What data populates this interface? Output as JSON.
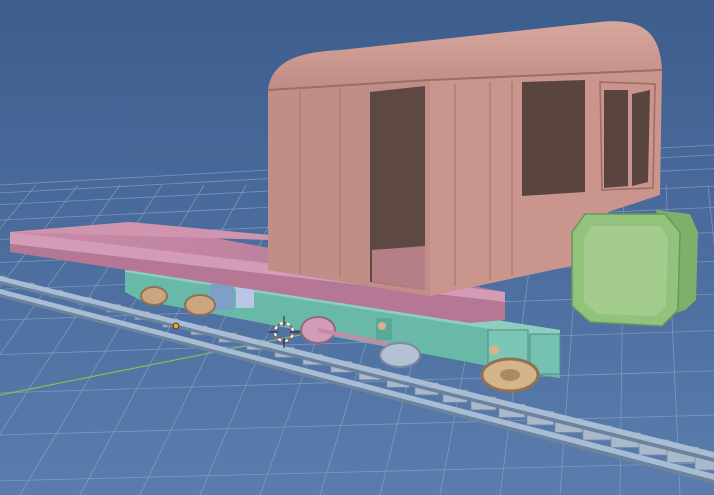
{
  "viewport": {
    "mode": "3d-viewport",
    "grid": "on",
    "colors": {
      "background_top": "#3e5f8f",
      "background_bottom": "#5b7fae",
      "grid_line": "#86a2c8",
      "x_axis": "#7fbf5a",
      "body_pink": "#c9938b",
      "body_shade": "#a9776f",
      "body_dark": "#5e4844",
      "deck_magenta": "#c585a4",
      "chassis_teal": "#69b9a9",
      "buffer_green": "#92c27c",
      "wheel_tan": "#d6b48a",
      "rail_steel": "#9fb3ca",
      "sleeper": "#aab8cb"
    }
  },
  "scene": {
    "objects": [
      {
        "name": "carriage-body",
        "icon": "body-shape"
      },
      {
        "name": "flatbed-deck",
        "icon": "deck-shape"
      },
      {
        "name": "chassis-frame",
        "icon": "frame-shape"
      },
      {
        "name": "buffer-block",
        "icon": "block-shape"
      },
      {
        "name": "wheelset",
        "icon": "wheel-shape"
      },
      {
        "name": "track-rails",
        "icon": "rail-shape"
      }
    ],
    "cursor_3d": "3d-cursor-icon",
    "origin_marker": "origin-dot-icon"
  }
}
